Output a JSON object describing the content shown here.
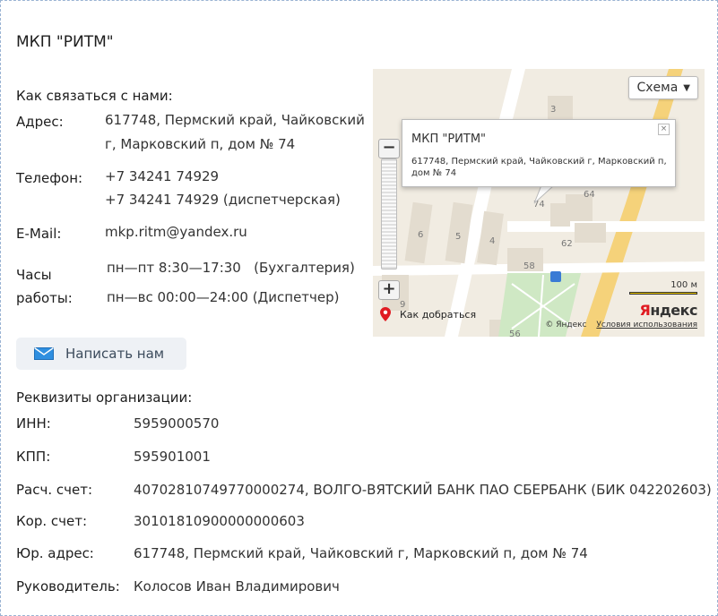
{
  "title": "МКП \"РИТМ\"",
  "contacts": {
    "heading": "Как связаться с нами:",
    "address_label": "Адрес:",
    "address_line1": "617748, Пермский край, Чайковский",
    "address_line2": "г, Марковский п, дом № 74",
    "phone_label": "Телефон:",
    "phone1": "+7 34241 74929",
    "phone2": "+7 34241 74929 (диспетчерская)",
    "email_label": "E-Mail:",
    "email": "mkp.ritm@yandex.ru",
    "hours_label_line1": "Часы",
    "hours_label_line2": "работы:",
    "hours1": "пн—пт 8:30—17:30   (Бухгалтерия)",
    "hours2": "пн—вс 00:00—24:00 (Диспетчер)"
  },
  "write_button": {
    "label": "Написать нам",
    "icon": "envelope-icon"
  },
  "map": {
    "scheme_label": "Схема",
    "balloon_title": "МКП \"РИТМ\"",
    "balloon_address": "617748, Пермский край, Чайковский г, Марковский п, дом № 74",
    "close_glyph": "×",
    "zoom_in": "+",
    "zoom_out": "−",
    "route_label": "Как добраться",
    "scale_label": "100 м",
    "logo_first": "Я",
    "logo_rest": "ндекс",
    "copyright": "© Яндекс",
    "terms": "Условия использования",
    "house_numbers": [
      "3",
      "64",
      "74",
      "62",
      "6",
      "5",
      "4",
      "58",
      "9",
      "56"
    ],
    "colors": {
      "road": "#ffffff",
      "building": "#e3dccf",
      "ground": "#f1ece2",
      "main_road": "#f5d27a",
      "green": "#cfe8c4"
    }
  },
  "requisites": {
    "heading": "Реквизиты организации:",
    "rows": [
      {
        "label": "ИНН:",
        "value": "5959000570"
      },
      {
        "label": "КПП:",
        "value": "595901001"
      },
      {
        "label": "Расч. счет:",
        "value": "40702810749770000274, ВОЛГО-ВЯТСКИЙ БАНК ПАО СБЕРБАНК (БИК 042202603)"
      },
      {
        "label": "Кор. счет:",
        "value": "30101810900000000603"
      },
      {
        "label": "Юр. адрес:",
        "value": "617748, Пермский край, Чайковский г, Марковский п, дом № 74"
      },
      {
        "label": "Руководитель:",
        "value": "Колосов Иван Владимирович"
      }
    ]
  }
}
